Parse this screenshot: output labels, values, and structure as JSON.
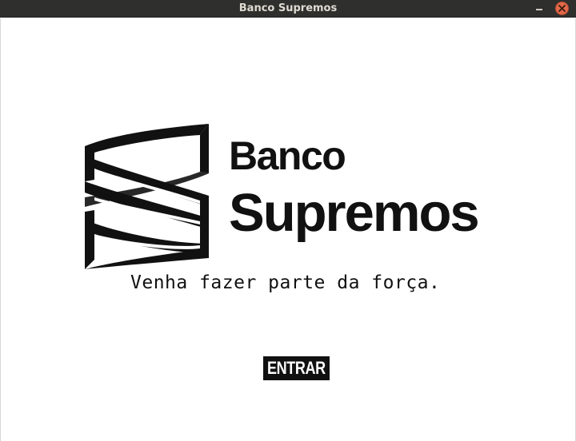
{
  "window": {
    "title": "Banco Supremos"
  },
  "brand": {
    "name_line1": "Banco",
    "name_line2": "Supremos",
    "tagline": "Venha fazer parte da força."
  },
  "actions": {
    "enter_label": "ENTRAR"
  },
  "colors": {
    "titlebar": "#2f2f2d",
    "close_button": "#e26a4a",
    "brand_ink": "#111111",
    "background": "#ffffff"
  },
  "icons": {
    "logo": "banco-supremos-logo-icon",
    "close": "close-icon",
    "minimize": "minimize-icon"
  }
}
